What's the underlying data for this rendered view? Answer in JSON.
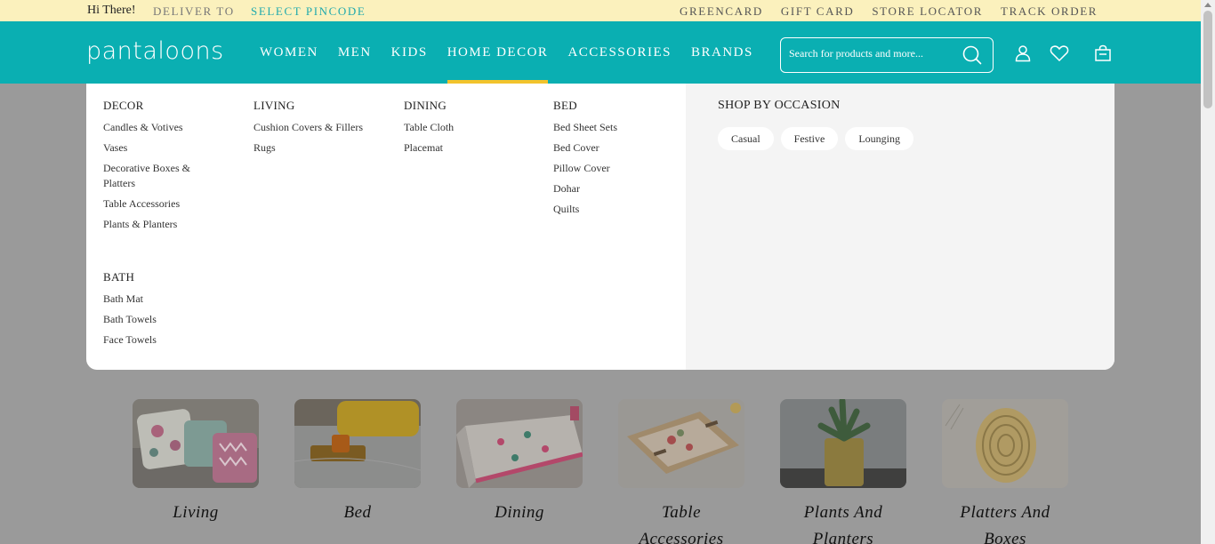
{
  "topbar": {
    "greeting": "Hi There!",
    "deliver_to": "DELIVER TO",
    "select_pincode": "SELECT PINCODE",
    "links": [
      "GREENCARD",
      "GIFT CARD",
      "STORE LOCATOR",
      "TRACK ORDER"
    ]
  },
  "header": {
    "logo": "pantaloons",
    "nav": [
      "WOMEN",
      "MEN",
      "KIDS",
      "HOME DECOR",
      "ACCESSORIES",
      "BRANDS"
    ],
    "active_nav": "HOME DECOR",
    "search_placeholder": "Search for products and more...",
    "icons": [
      "search-icon",
      "user-icon",
      "heart-icon",
      "bag-icon"
    ]
  },
  "mega_menu": {
    "columns": [
      {
        "heading": "DECOR",
        "links": [
          "Candles & Votives",
          "Vases",
          "Decorative Boxes & Platters",
          "Table Accessories",
          "Plants & Planters"
        ]
      },
      {
        "heading": "LIVING",
        "links": [
          "Cushion Covers & Fillers",
          "Rugs"
        ]
      },
      {
        "heading": "DINING",
        "links": [
          "Table Cloth",
          "Placemat"
        ]
      },
      {
        "heading": "BED",
        "links": [
          "Bed Sheet Sets",
          "Bed Cover",
          "Pillow Cover",
          "Dohar",
          "Quilts"
        ]
      },
      {
        "heading": "BATH",
        "links": [
          "Bath Mat",
          "Bath Towels",
          "Face Towels"
        ]
      }
    ],
    "occasion": {
      "title": "SHOP BY OCCASION",
      "chips": [
        "Casual",
        "Festive",
        "Lounging"
      ]
    }
  },
  "categories": [
    {
      "label": "Living"
    },
    {
      "label": "Bed"
    },
    {
      "label": "Dining"
    },
    {
      "label": "Table Accessories"
    },
    {
      "label": "Plants And Planters"
    },
    {
      "label": "Platters And Boxes"
    }
  ],
  "colors": {
    "header_teal": "#0aafb2",
    "topbar_yellow": "#fbf1bd",
    "active_underline": "#f2c32c",
    "overlay_gray": "#9a9a9a"
  }
}
